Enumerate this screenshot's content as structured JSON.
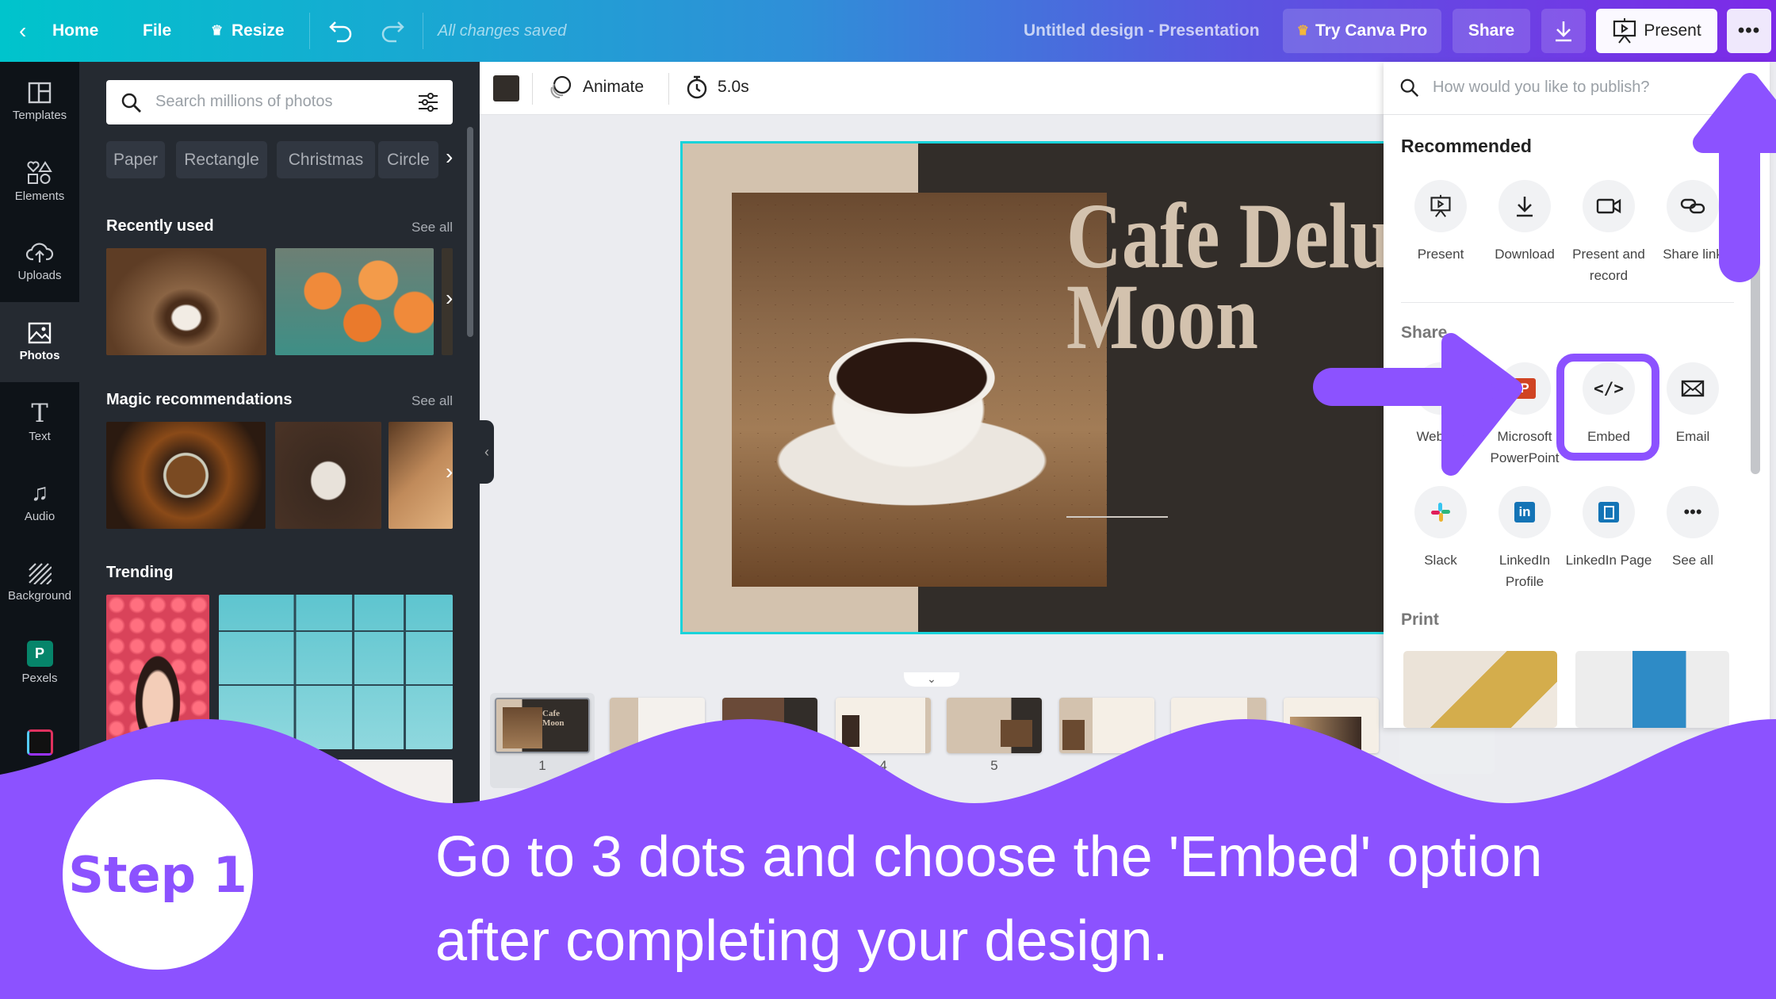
{
  "topbar": {
    "home": "Home",
    "file": "File",
    "resize": "Resize",
    "save_status": "All changes saved",
    "doc_title": "Untitled design - Presentation",
    "try_pro": "Try Canva Pro",
    "share": "Share",
    "present": "Present",
    "gradient": [
      "#00c4cc",
      "#7d2ae8"
    ]
  },
  "rail": {
    "items": [
      {
        "label": "Templates",
        "icon": "templates-icon"
      },
      {
        "label": "Elements",
        "icon": "elements-icon"
      },
      {
        "label": "Uploads",
        "icon": "upload-cloud-icon"
      },
      {
        "label": "Photos",
        "icon": "photos-icon",
        "active": true
      },
      {
        "label": "Text",
        "icon": "text-icon"
      },
      {
        "label": "Audio",
        "icon": "music-note-icon"
      },
      {
        "label": "Background",
        "icon": "background-hatch-icon"
      },
      {
        "label": "Pexels",
        "icon": "pexels-icon"
      },
      {
        "label": "",
        "icon": "giphy-icon"
      }
    ]
  },
  "photos_panel": {
    "search_placeholder": "Search millions of photos",
    "chips": [
      "Paper",
      "Rectangle",
      "Christmas",
      "Circle"
    ],
    "recently_used": "Recently used",
    "magic": "Magic recommendations",
    "trending": "Trending",
    "see_all": "See all"
  },
  "toolbar": {
    "animate": "Animate",
    "duration": "5.0s",
    "swatch_color": "#322d29"
  },
  "slide": {
    "title_line1": "Cafe Deluca",
    "title_line2": "Moon"
  },
  "thumbnails": {
    "numbers": [
      "1",
      "",
      "",
      "4",
      "5",
      "",
      "",
      ""
    ]
  },
  "publish": {
    "search_placeholder": "How would you like to publish?",
    "recommended": "Recommended",
    "recommended_items": [
      "Present",
      "Download",
      "Present and record",
      "Share link"
    ],
    "share": "Share",
    "share_items": [
      "Website",
      "Microsoft PowerPoint",
      "Embed",
      "Email",
      "Slack",
      "LinkedIn Profile",
      "LinkedIn Page",
      "See all"
    ],
    "print": "Print",
    "highlighted": "Embed"
  },
  "tutorial": {
    "step": "Step 1",
    "line1": "Go to 3 dots and choose the 'Embed' option",
    "line2": "after completing your design.",
    "accent": "#8c52ff"
  }
}
